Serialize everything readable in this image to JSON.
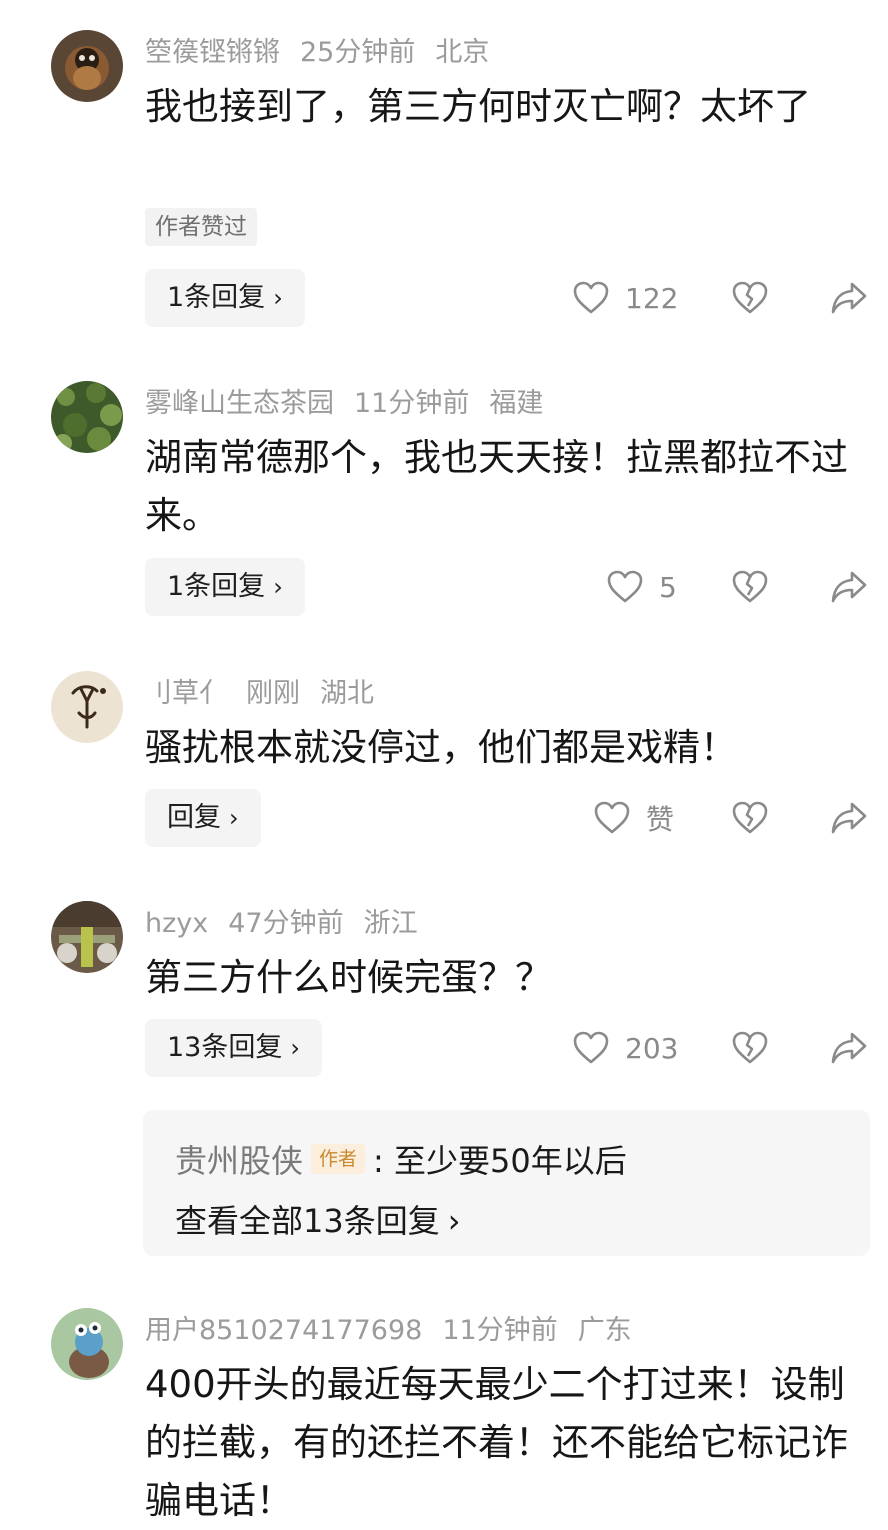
{
  "comments": [
    {
      "username": "箜篌铿锵锵",
      "time": "25分钟前",
      "location": "北京",
      "text": "我也接到了，第三方何时灭亡啊？太坏了",
      "badge": "作者赞过",
      "reply_label": "1条回复",
      "like_count": "122"
    },
    {
      "username": "雾峰山生态茶园",
      "time": "11分钟前",
      "location": "福建",
      "text": "湖南常德那个，我也天天接！拉黑都拉不过来。",
      "reply_label": "1条回复",
      "like_count": "5"
    },
    {
      "username": "刂草亻",
      "time": "刚刚",
      "location": "湖北",
      "text": "骚扰根本就没停过，他们都是戏精！",
      "reply_label": "回复",
      "like_count": "赞"
    },
    {
      "username": "hzyx",
      "time": "47分钟前",
      "location": "浙江",
      "text": "第三方什么时候完蛋？？",
      "reply_label": "13条回复",
      "like_count": "203",
      "sub_reply": {
        "author": "贵州股侠",
        "author_tag": "作者",
        "text": ": 至少要50年以后",
        "view_all": "查看全部13条回复"
      }
    },
    {
      "username": "用户8510274177698",
      "time": "11分钟前",
      "location": "广东",
      "text": "400开头的最近每天最少二个打过来！设制的拦截，有的还拦不着！还不能给它标记诈骗电话！"
    }
  ],
  "icons": {
    "like": "heart-outline-icon",
    "dislike": "broken-heart-icon",
    "share": "share-arrow-icon",
    "chevron": "chevron-right-icon"
  },
  "colors": {
    "meta_text": "#9b9b9b",
    "body_text": "#161616",
    "author_tag_text": "#c88a2f",
    "author_tag_bg": "#fbeedd",
    "pill_bg": "#f4f4f4"
  }
}
